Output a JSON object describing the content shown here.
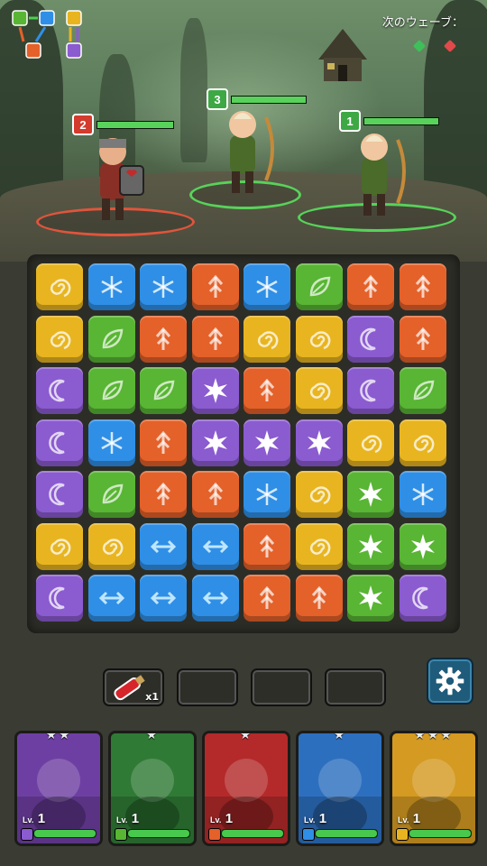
{
  "hud": {
    "next_wave_label": "次のウェーブ：",
    "next_wave_gems": [
      "#3fbf5a",
      "#e04a4a"
    ]
  },
  "enemies": [
    {
      "name": "red-knight",
      "level": "2",
      "hp_fraction": 1.0,
      "ring_color": "#e0553b",
      "badge_color": "#d33b2c"
    },
    {
      "name": "elf-archer",
      "level": "3",
      "hp_fraction": 1.0,
      "ring_color": "#58d25a",
      "badge_color": "#3da844"
    },
    {
      "name": "elf-archer",
      "level": "1",
      "hp_fraction": 1.0,
      "ring_color": "#58d25a",
      "badge_color": "#3da844"
    }
  ],
  "board": {
    "colors": {
      "yellow": "#e8b520",
      "blue": "#2f8fe6",
      "orange": "#e4612a",
      "green": "#59b534",
      "purple": "#8b5bd0"
    },
    "icons": {
      "yellow": "spiral-icon",
      "blue": "snowflake-icon",
      "orange": "arrow-up-icon",
      "green": "leaf-icon",
      "purple": "moon-icon",
      "purple-burst": "burst-icon",
      "green-burst": "burst-icon",
      "blue-arrow": "double-arrow-icon"
    },
    "rows": [
      [
        "yellow",
        "blue",
        "blue",
        "orange",
        "blue",
        "green",
        "orange",
        "orange"
      ],
      [
        "yellow",
        "green",
        "orange",
        "orange",
        "yellow",
        "yellow",
        "purple",
        "orange"
      ],
      [
        "purple",
        "green",
        "green",
        "purple-burst",
        "orange",
        "yellow",
        "purple",
        "green"
      ],
      [
        "purple",
        "blue",
        "orange",
        "purple-burst",
        "purple-burst",
        "purple-burst",
        "yellow",
        "yellow"
      ],
      [
        "purple",
        "green",
        "orange",
        "orange",
        "blue",
        "yellow",
        "green-burst",
        "blue"
      ],
      [
        "yellow",
        "yellow",
        "blue-arrow",
        "blue-arrow",
        "orange",
        "yellow",
        "green-burst",
        "green-burst"
      ],
      [
        "purple",
        "blue-arrow",
        "blue-arrow",
        "blue-arrow",
        "orange",
        "orange",
        "green-burst",
        "purple"
      ]
    ]
  },
  "items": {
    "potion_count": "x1",
    "empty_slots": 3
  },
  "heroes": [
    {
      "name": "imp-hero",
      "stars": "★★",
      "lv_label": "Lv.",
      "level": "1",
      "bg": "#6e3fa3",
      "gem": "#8b5bd0"
    },
    {
      "name": "goblin-hero",
      "stars": "★",
      "lv_label": "Lv.",
      "level": "1",
      "bg": "#2f7a35",
      "gem": "#59b534"
    },
    {
      "name": "knight-hero",
      "stars": "★",
      "lv_label": "Lv.",
      "level": "1",
      "bg": "#b42a2a",
      "gem": "#e4612a"
    },
    {
      "name": "mushroom-hero",
      "stars": "★",
      "lv_label": "Lv.",
      "level": "1",
      "bg": "#2d6fbf",
      "gem": "#2f8fe6"
    },
    {
      "name": "dwarf-king-hero",
      "stars": "★★★",
      "lv_label": "Lv.",
      "level": "1",
      "bg": "#d49a22",
      "gem": "#e8b520"
    }
  ]
}
